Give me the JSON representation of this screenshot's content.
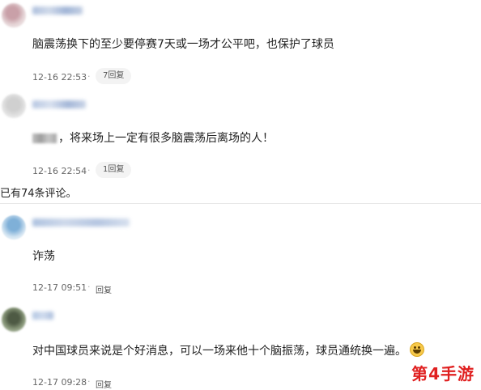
{
  "comments": [
    {
      "text": "脑震荡换下的至少要停赛7天或一场才公平吧，也保护了球员",
      "time": "12-16 22:53",
      "reply_label": "7回复"
    },
    {
      "text": "，将来场上一定有很多脑震荡后离场的人！",
      "time": "12-16 22:54",
      "reply_label": "1回复"
    },
    {
      "text": "诈荡",
      "time": "12-17 09:51",
      "reply_label": "回复"
    },
    {
      "text": "对中国球员来说是个好消息，可以一场来他十个脑振荡，球员通统换一遍。",
      "time": "12-17 09:28",
      "reply_label": "回复"
    }
  ],
  "summary": "已有74条评论。",
  "watermark": "第4手游",
  "icons": {
    "emoji": "laughing-face-icon"
  }
}
